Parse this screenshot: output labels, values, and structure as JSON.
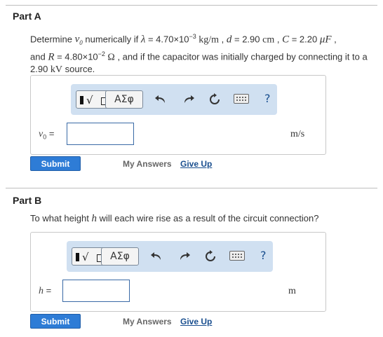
{
  "partA": {
    "title": "Part A",
    "q_determine": "Determine ",
    "q_v0": "v",
    "q_v0_sub": "0",
    "q_numerically": " numerically if ",
    "q_lambda": "λ",
    "q_lambda_eq": " = 4.70×10",
    "q_lambda_exp": "−3",
    "q_lambda_unit": " kg/m",
    "q_comma1": " , ",
    "q_d": "d",
    "q_d_val": " = 2.90 ",
    "q_d_unit": "cm",
    "q_comma2": " , ",
    "q_C": "C",
    "q_C_val": " = 2.20 ",
    "q_C_unit": "μF",
    "q_comma3": " ,",
    "q_and": "and ",
    "q_R": "R",
    "q_R_val": " = 4.80×10",
    "q_R_exp": "−2",
    "q_R_unit": " Ω",
    "q_rest": " , and if the capacitor was initially charged by connecting it to a",
    "q_source_val": "2.90 ",
    "q_source_unit": "kV",
    "q_source_text": " source.",
    "var_label_main": "v",
    "var_label_sub": "0",
    "var_label_eq": " =",
    "input_value": "",
    "unit": "m/s",
    "submit": "Submit",
    "my_answers": "My Answers",
    "give_up": "Give Up"
  },
  "partB": {
    "title": "Part B",
    "q_pre": "To what height ",
    "q_h": "h",
    "q_post": " will each wire rise as a result of the circuit connection?",
    "var_label_main": "h",
    "var_label_eq": " =",
    "input_value": "",
    "unit": "m",
    "submit": "Submit",
    "my_answers": "My Answers",
    "give_up": "Give Up"
  },
  "toolbar": {
    "greek_label": "ΑΣφ",
    "sqrt_glyph": "√",
    "help_label": "?",
    "icons": [
      "templates-icon",
      "greek-letters-icon",
      "undo-icon",
      "redo-icon",
      "reset-icon",
      "keyboard-icon",
      "help-icon"
    ]
  },
  "colors": {
    "toolbar_bg": "#d0e0f1",
    "submit_bg": "#2e7cd6",
    "link": "#1a4f8f",
    "rule": "#bdbdbd"
  }
}
